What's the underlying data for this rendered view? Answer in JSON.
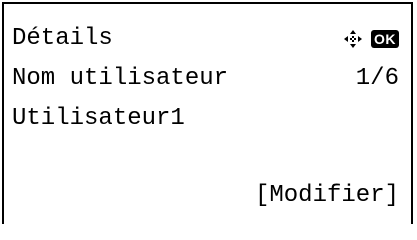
{
  "screen": {
    "title": "Détails",
    "field_label": "Nom utilisateur",
    "page_indicator": "1/6",
    "field_value": "Utilisateur1",
    "softkey_label": "[Modifier]",
    "ok_label": "OK",
    "nav_icon": "dpad-arrows-icon"
  }
}
